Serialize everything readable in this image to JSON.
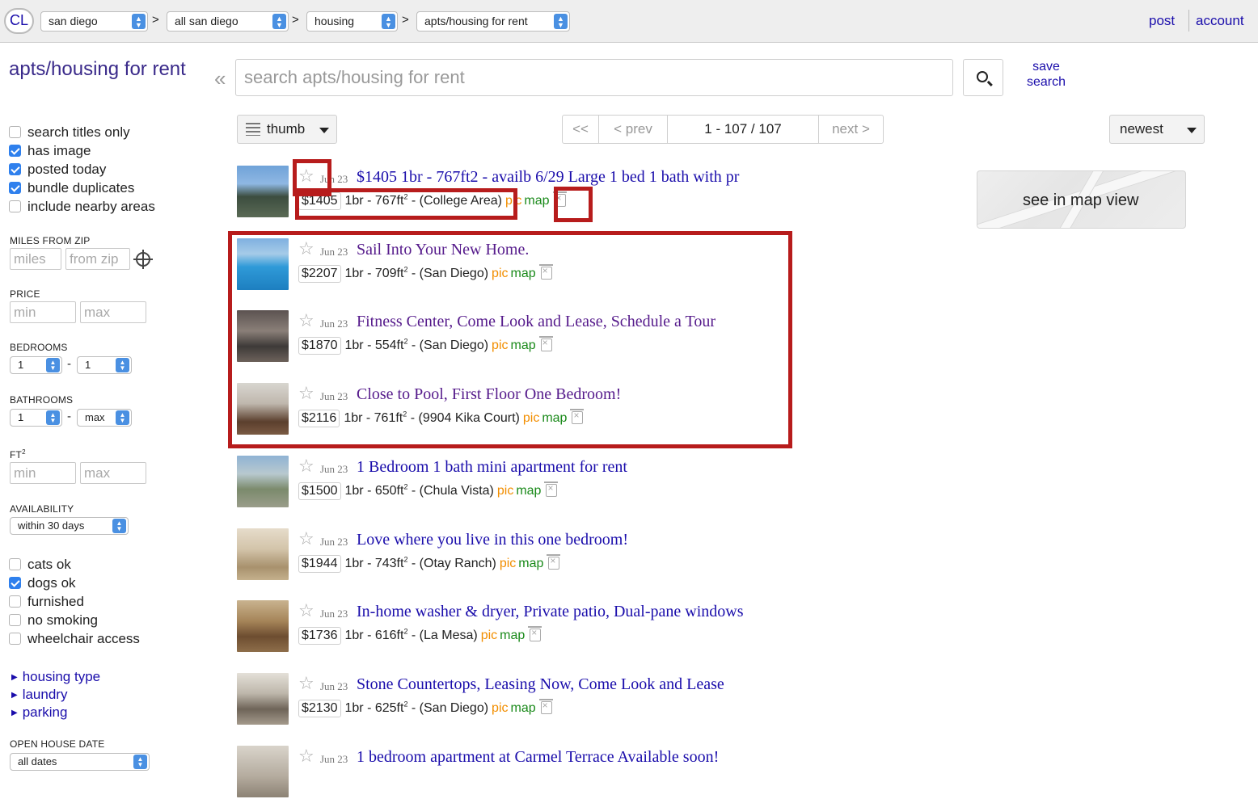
{
  "header": {
    "logo": "CL",
    "breadcrumbs": [
      {
        "label": "san diego"
      },
      {
        "label": "all san diego"
      },
      {
        "label": "housing"
      },
      {
        "label": "apts/housing for rent"
      }
    ],
    "separator": ">",
    "post_label": "post",
    "account_label": "account"
  },
  "sidebar": {
    "title": "apts/housing for rent",
    "collapse_icon": "«",
    "filters": [
      {
        "label": "search titles only",
        "checked": false
      },
      {
        "label": "has image",
        "checked": true
      },
      {
        "label": "posted today",
        "checked": true
      },
      {
        "label": "bundle duplicates",
        "checked": true
      },
      {
        "label": "include nearby areas",
        "checked": false
      }
    ],
    "miles_label": "MILES FROM ZIP",
    "miles_placeholder": "miles",
    "zip_placeholder": "from zip",
    "price_label": "PRICE",
    "price_min": "min",
    "price_max": "max",
    "bedrooms_label": "BEDROOMS",
    "bedrooms_min": "1",
    "bedrooms_max": "1",
    "bathrooms_label": "BATHROOMS",
    "bathrooms_min": "1",
    "bathrooms_max": "max",
    "ft_label": "FT",
    "ft_sup": "2",
    "ft_min": "min",
    "ft_max": "max",
    "availability_label": "AVAILABILITY",
    "availability_value": "within 30 days",
    "range_dash": "-",
    "amenities": [
      {
        "label": "cats ok",
        "checked": false
      },
      {
        "label": "dogs ok",
        "checked": true
      },
      {
        "label": "furnished",
        "checked": false
      },
      {
        "label": "no smoking",
        "checked": false
      },
      {
        "label": "wheelchair access",
        "checked": false
      }
    ],
    "expanders": [
      "housing type",
      "laundry",
      "parking"
    ],
    "open_house_label": "OPEN HOUSE DATE",
    "open_house_value": "all dates"
  },
  "search": {
    "placeholder": "search apts/housing for rent",
    "save_label": "save search"
  },
  "toolbar": {
    "view_mode": "thumb",
    "pager_first": "<<",
    "pager_prev": "< prev",
    "pager_range": "1 - 107 / 107",
    "pager_next": "next >",
    "sort": "newest"
  },
  "map": {
    "label": "see in map view"
  },
  "listings": [
    {
      "date": "Jun 23",
      "title": "$1405 1br - 767ft2 - availb 6/29 Large 1 bed 1 bath with pr",
      "price": "$1405",
      "details": "1br - 767ft",
      "area": " - (College Area)",
      "visited": false
    },
    {
      "date": "Jun 23",
      "title": "Sail Into Your New Home.",
      "price": "$2207",
      "details": "1br - 709ft",
      "area": " - (San Diego)",
      "visited": true
    },
    {
      "date": "Jun 23",
      "title": "Fitness Center, Come Look and Lease, Schedule a Tour",
      "price": "$1870",
      "details": "1br - 554ft",
      "area": " - (San Diego)",
      "visited": true
    },
    {
      "date": "Jun 23",
      "title": "Close to Pool, First Floor One Bedroom!",
      "price": "$2116",
      "details": "1br - 761ft",
      "area": " - (9904 Kika Court)",
      "visited": true
    },
    {
      "date": "Jun 23",
      "title": "1 Bedroom 1 bath mini apartment for rent",
      "price": "$1500",
      "details": "1br - 650ft",
      "area": " - (Chula Vista)",
      "visited": false
    },
    {
      "date": "Jun 23",
      "title": "Love where you live in this one bedroom!",
      "price": "$1944",
      "details": "1br - 743ft",
      "area": " - (Otay Ranch)",
      "visited": false
    },
    {
      "date": "Jun 23",
      "title": "In-home washer & dryer, Private patio, Dual-pane windows",
      "price": "$1736",
      "details": "1br - 616ft",
      "area": " - (La Mesa)",
      "visited": false
    },
    {
      "date": "Jun 23",
      "title": "Stone Countertops, Leasing Now, Come Look and Lease",
      "price": "$2130",
      "details": "1br - 625ft",
      "area": " - (San Diego)",
      "visited": false
    },
    {
      "date": "Jun 23",
      "title": "1 bedroom apartment at Carmel Terrace Available soon!",
      "price": "",
      "details": "",
      "area": "",
      "visited": false
    }
  ],
  "listing_labels": {
    "sup": "2",
    "pic": "pic",
    "map": "map",
    "star": "☆"
  },
  "colors": {
    "link": "#1a0dab",
    "visited": "#551a8b",
    "pic": "#f28e00",
    "map": "#1a8a1a",
    "highlight": "#b71c1c"
  }
}
